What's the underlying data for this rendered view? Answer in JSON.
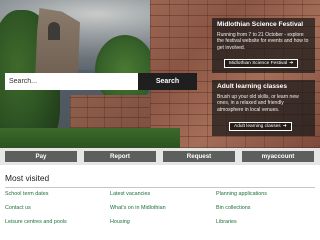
{
  "search": {
    "placeholder": "Search...",
    "button_label": "Search"
  },
  "promos": [
    {
      "title": "Midlothian Science Festival",
      "text": "Running from 7 to 21 October - explore the festival website for events and how to get involved.",
      "button_label": "Midlothian Science Festival",
      "button_icon": "external-link-icon"
    },
    {
      "title": "Adult learning classes",
      "text": "Brush up your old skills, or learn new ones, in a relaxed and friendly atmosphere in local venues.",
      "button_label": "Adult learning classes",
      "button_icon": "external-link-icon"
    }
  ],
  "actions": [
    {
      "label": "Pay"
    },
    {
      "label": "Report"
    },
    {
      "label": "Request"
    },
    {
      "label": "myaccount"
    }
  ],
  "most_visited": {
    "title": "Most visited",
    "links": [
      [
        "School term dates",
        "Latest vacancies",
        "Planning applications"
      ],
      [
        "Contact us",
        "What's on in Midlothian",
        "Bin collections"
      ],
      [
        "Leisure centres and pools",
        "Housing",
        "Libraries"
      ]
    ]
  },
  "colors": {
    "link": "#1d6f3b",
    "action_button": "#5c5f5c",
    "action_bar": "#e6e6e6",
    "search_button": "#1f1f1f"
  }
}
